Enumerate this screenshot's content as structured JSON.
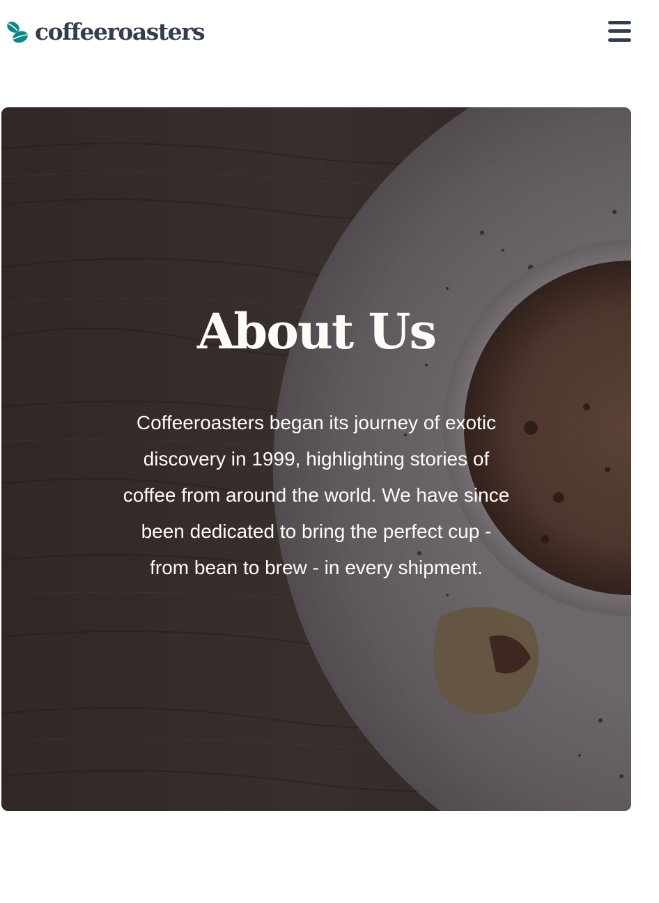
{
  "header": {
    "logo_text": "coffeeroasters",
    "logo_icon": "coffee-bean-leaves-icon",
    "menu_icon": "hamburger-menu-icon"
  },
  "hero": {
    "title": "About Us",
    "description": "Coffeeroasters began its journey of exotic discovery in 1999, highlighting stories of coffee from around the world. We have since been dedicated to bring the perfect cup - from bean to brew - in every shipment."
  },
  "colors": {
    "brand_dark": "#333d4b",
    "brand_teal": "#0e8784",
    "hero_text": "#fefcf7"
  }
}
